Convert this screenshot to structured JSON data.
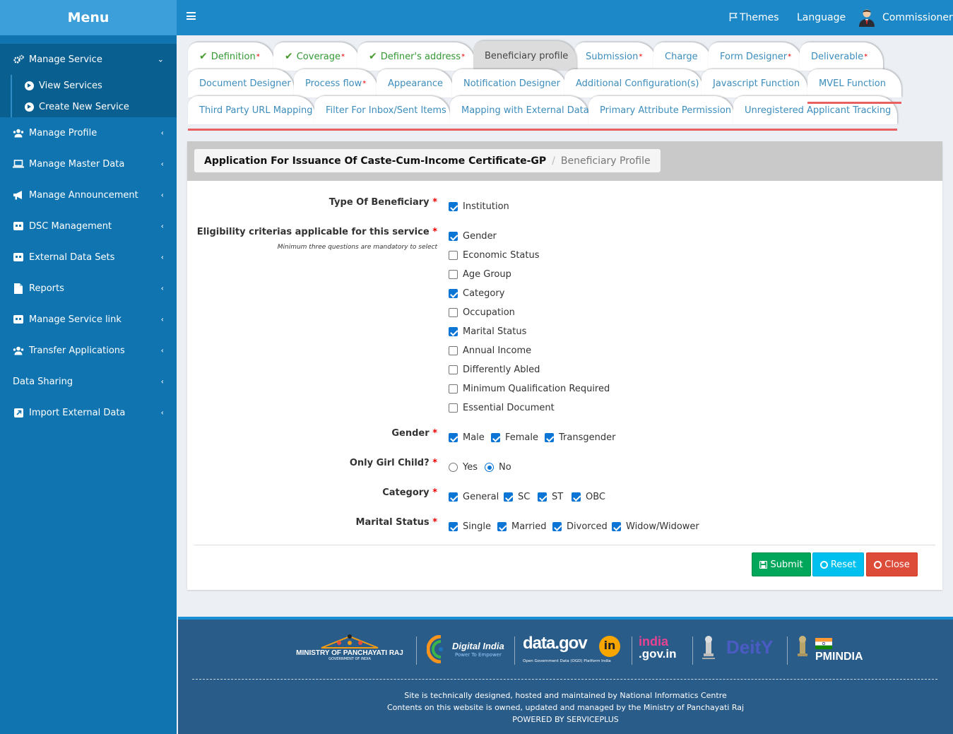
{
  "sidebar": {
    "title": "Menu",
    "items": [
      {
        "label": "Manage Service",
        "icon": "gears-icon"
      },
      {
        "label": "Manage Profile",
        "icon": "users-icon"
      },
      {
        "label": "Manage Master Data",
        "icon": "laptop-icon"
      },
      {
        "label": "Manage Announcement",
        "icon": "bullhorn-icon"
      },
      {
        "label": "DSC Management",
        "icon": "card-icon"
      },
      {
        "label": "External Data Sets",
        "icon": "card-icon"
      },
      {
        "label": "Reports",
        "icon": "file-icon"
      },
      {
        "label": "Manage Service link",
        "icon": "card-icon"
      },
      {
        "label": "Transfer Applications",
        "icon": "users-icon"
      },
      {
        "label": "Data Sharing",
        "icon": ""
      },
      {
        "label": "Import External Data",
        "icon": "external-icon"
      }
    ],
    "sub_items": [
      "View Services",
      "Create New Service"
    ]
  },
  "topbar": {
    "themes": "Themes",
    "language": "Language",
    "user": "Commissioner"
  },
  "tabs": {
    "row1": [
      "Definition",
      "Coverage",
      "Definer's address",
      "Beneficiary profile",
      "Submission",
      "Charge",
      "Form Designer",
      "Deliverable"
    ],
    "row2": [
      "Document Designer",
      "Process flow",
      "Appearance",
      "Notification Designer",
      "Additional Configuration(s)",
      "Javascript Function",
      "MVEL Function"
    ],
    "row3": [
      "Third Party URL Mapping",
      "Filter For Inbox/Sent Items",
      "Mapping with External Data",
      "Primary Attribute Permission",
      "Unregistered Applicant Tracking"
    ],
    "required_mark": "*"
  },
  "breadcrumb": {
    "service": "Application For Issuance Of Caste-Cum-Income Certificate-GP",
    "separator": "/",
    "current": "Beneficiary Profile"
  },
  "form": {
    "required_mark": "*",
    "type_label": "Type Of Beneficiary",
    "type_options": [
      {
        "label": "Institution",
        "checked": true
      }
    ],
    "eligibility_label": "Eligibility criterias applicable for this service",
    "eligibility_hint": "Minimum three questions are mandatory to select",
    "eligibility_options": [
      {
        "label": "Gender",
        "checked": true
      },
      {
        "label": "Economic Status",
        "checked": false
      },
      {
        "label": "Age Group",
        "checked": false
      },
      {
        "label": "Category",
        "checked": true
      },
      {
        "label": "Occupation",
        "checked": false
      },
      {
        "label": "Marital Status",
        "checked": true
      },
      {
        "label": "Annual Income",
        "checked": false
      },
      {
        "label": "Differently Abled",
        "checked": false
      },
      {
        "label": "Minimum Qualification Required",
        "checked": false
      },
      {
        "label": "Essential Document",
        "checked": false
      }
    ],
    "gender_label": "Gender",
    "gender_options": [
      {
        "label": "Male",
        "checked": true
      },
      {
        "label": "Female",
        "checked": true
      },
      {
        "label": "Transgender",
        "checked": true
      }
    ],
    "girl_label": "Only Girl Child?",
    "girl_options": [
      {
        "label": "Yes",
        "selected": false
      },
      {
        "label": "No",
        "selected": true
      }
    ],
    "category_label": "Category",
    "category_options": [
      {
        "label": "General",
        "checked": true
      },
      {
        "label": "SC",
        "checked": true
      },
      {
        "label": "ST",
        "checked": true
      },
      {
        "label": "OBC",
        "checked": true
      }
    ],
    "marital_label": "Marital Status",
    "marital_options": [
      {
        "label": "Single",
        "checked": true
      },
      {
        "label": "Married",
        "checked": true
      },
      {
        "label": "Divorced",
        "checked": true
      },
      {
        "label": "Widow/Widower",
        "checked": true
      }
    ]
  },
  "buttons": {
    "submit": "Submit",
    "reset": "Reset",
    "close": "Close"
  },
  "colors": {
    "submit": "#00a65a",
    "reset": "#00c0ef",
    "close": "#dd4b39",
    "sidebar": "#0f74b0",
    "topbar": "#1c88c7"
  },
  "footer": {
    "logos": {
      "panchayati": "MINISTRY OF PANCHAYATI RAJ",
      "panchayati_sub": "GOVERNMENT OF INDIA",
      "digital_india": "Digital India",
      "digital_india_sub": "Power To Empower",
      "datagov": "data.gov",
      "datagov_in": "in",
      "datagov_sub": "Open Government Data (OGD) Platform India",
      "indiagov_top": "india",
      "indiagov_bottom": ".gov.in",
      "deity": "DeitY",
      "pmindia": "PMINDIA"
    },
    "line1": "Site is technically designed, hosted and maintained by National Informatics Centre",
    "line2": "Contents on this website is owned, updated and managed by the Ministry of Panchayati Raj",
    "line3": "POWERED BY SERVICEPLUS"
  }
}
